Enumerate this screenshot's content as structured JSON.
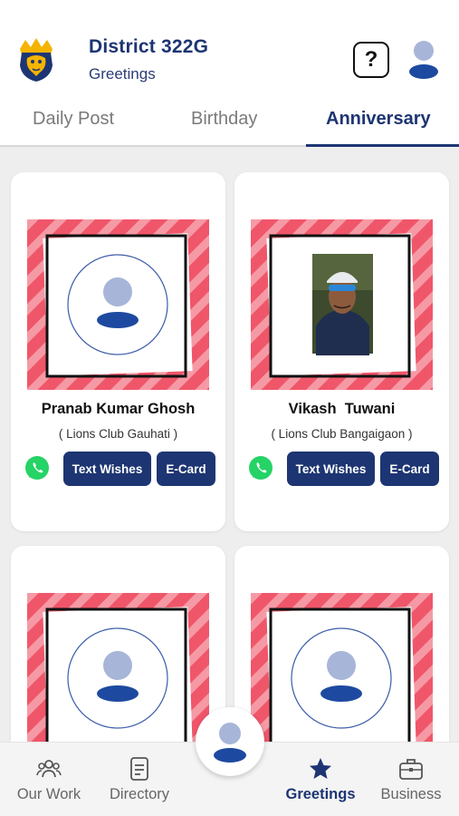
{
  "header": {
    "title": "District 322G",
    "subtitle": "Greetings",
    "help_glyph": "?"
  },
  "tabs": [
    {
      "label": "Daily Post",
      "active": false
    },
    {
      "label": "Birthday",
      "active": false
    },
    {
      "label": "Anniversary",
      "active": true
    }
  ],
  "cards": [
    {
      "name": "Pranab Kumar Ghosh",
      "club": "( Lions Club Gauhati )",
      "has_photo": false,
      "text_wishes_label": "Text Wishes",
      "ecard_label": "E-Card"
    },
    {
      "name": "Vikash  Tuwani",
      "club": "( Lions Club Bangaigaon )",
      "has_photo": true,
      "text_wishes_label": "Text Wishes",
      "ecard_label": "E-Card"
    },
    {
      "name": "",
      "club": "",
      "has_photo": false
    },
    {
      "name": "",
      "club": "",
      "has_photo": false
    }
  ],
  "bottom_nav": [
    {
      "label": "Our Work",
      "icon": "people-icon",
      "active": false
    },
    {
      "label": "Directory",
      "icon": "document-icon",
      "active": false
    },
    {
      "label": "Greetings",
      "icon": "star-icon",
      "active": true
    },
    {
      "label": "Business",
      "icon": "briefcase-icon",
      "active": false
    }
  ],
  "colors": {
    "primary": "#1d3572",
    "frame_red": "#f0566a",
    "whatsapp": "#25d366",
    "avatar_light": "#a7b5d8"
  }
}
